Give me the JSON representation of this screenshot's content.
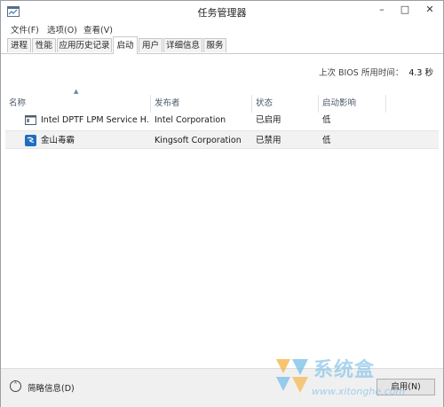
{
  "window": {
    "title": "任务管理器",
    "minimize": "–",
    "maximize": "□",
    "close": "✕"
  },
  "menu": [
    "文件(F)",
    "选项(O)",
    "查看(V)"
  ],
  "tabs": [
    {
      "label": "进程",
      "active": false
    },
    {
      "label": "性能",
      "active": false
    },
    {
      "label": "应用历史记录",
      "active": false
    },
    {
      "label": "启动",
      "active": true
    },
    {
      "label": "用户",
      "active": false
    },
    {
      "label": "详细信息",
      "active": false
    },
    {
      "label": "服务",
      "active": false
    }
  ],
  "bios": {
    "label": "上次 BIOS 所用时间：",
    "value": "4.3 秒"
  },
  "columns": [
    "名称",
    "发布者",
    "状态",
    "启动影响"
  ],
  "rows": [
    {
      "icon": "app-window-icon",
      "name": "Intel DPTF LPM Service H...",
      "publisher": "Intel Corporation",
      "status": "已启用",
      "impact": "低"
    },
    {
      "icon": "kingsoft-antivirus-icon",
      "name": "金山毒霸",
      "publisher": "Kingsoft Corporation",
      "status": "已禁用",
      "impact": "低"
    }
  ],
  "footer": {
    "fewer_details": "简略信息(D)",
    "enable_button": "启用(N)"
  },
  "watermark": {
    "text": "系统盒",
    "url": "www.xitonghe.com"
  },
  "colors": {
    "accent": "#2f7fc4",
    "watermark": "#8ec7ea",
    "footer_bg": "#f0f0f0"
  }
}
